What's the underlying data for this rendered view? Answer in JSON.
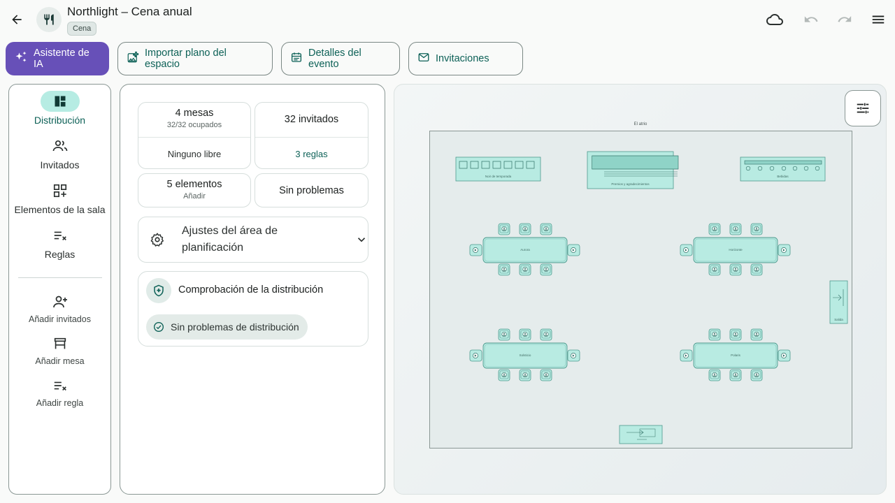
{
  "header": {
    "title": "Northlight – Cena anual",
    "tag": "Cena"
  },
  "actions": {
    "ai": "Asistente de IA",
    "import": "Importar plano del espacio",
    "details": "Detalles del evento",
    "invites": "Invitaciones"
  },
  "nav": {
    "items": [
      {
        "label": "Distribución",
        "icon": "layout-icon"
      },
      {
        "label": "Invitados",
        "icon": "people-icon"
      },
      {
        "label": "Elementos de la sala",
        "icon": "grid-add-icon"
      },
      {
        "label": "Reglas",
        "icon": "rules-icon"
      }
    ],
    "quick": [
      {
        "label": "Añadir invitados",
        "icon": "person-add-icon"
      },
      {
        "label": "Añadir mesa",
        "icon": "table-icon"
      },
      {
        "label": "Añadir regla",
        "icon": "rule-add-icon"
      }
    ]
  },
  "stats": {
    "tables": "4 mesas",
    "occupied": "32/32 ocupados",
    "free": "Ninguno libre",
    "guests": "32 invitados",
    "rules": "3 reglas",
    "elements": "5 elementos",
    "add": "Añadir",
    "problems": "Sin problemas"
  },
  "settings": {
    "label": "Ajustes del área de planificación"
  },
  "check": {
    "title": "Comprobación de la distribución",
    "status": "Sin problemas de distribución"
  },
  "floor": {
    "room": "El atrio",
    "elements": [
      "Noir de temporada",
      "Premios y agradecimientos",
      "Bebidas",
      "Salida"
    ],
    "tables": [
      "Aurora",
      "Horizonte",
      "Solsticio",
      "Polaris"
    ]
  },
  "colors": {
    "accent": "#0d6157",
    "ai": "#6750b8",
    "teal_fill": "#b8ebe2"
  }
}
